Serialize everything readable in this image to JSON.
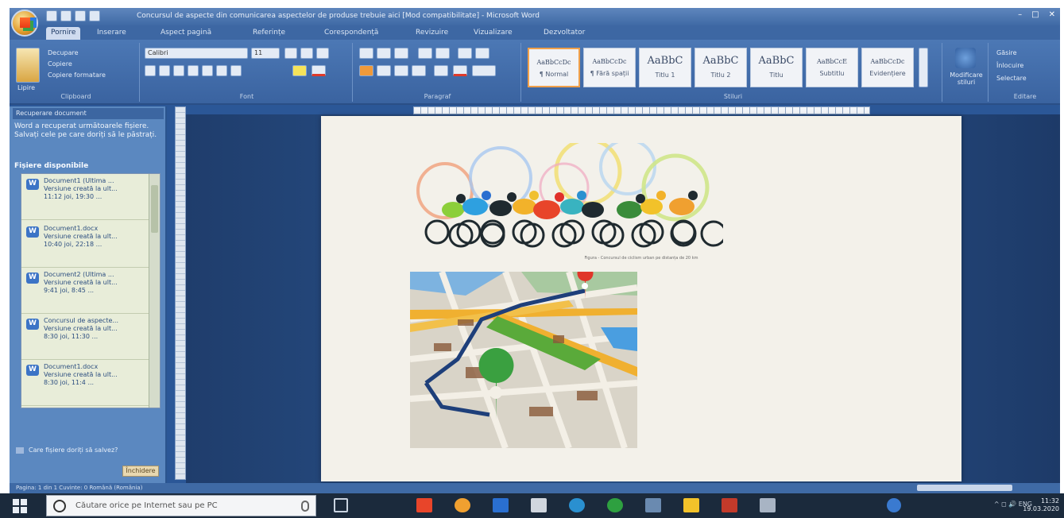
{
  "window": {
    "title": "Concursul de aspecte din comunicarea aspectelor de produse trebuie aici [Mod compatibilitate] - Microsoft Word",
    "controls": [
      "–",
      "□",
      "✕"
    ]
  },
  "tabs": [
    "Pornire",
    "Inserare",
    "Aspect pagină",
    "Referințe",
    "Corespondență",
    "Revizuire",
    "Vizualizare",
    "Dezvoltator"
  ],
  "ribbon": {
    "clipboard": {
      "paste": "Lipire",
      "cut": "Decupare",
      "copy": "Copiere",
      "format_painter": "Copiere formatare",
      "label": "Clipboard"
    },
    "font": {
      "name": "Calibri",
      "size": "11",
      "label": "Font"
    },
    "paragraph": {
      "label": "Paragraf"
    },
    "styles": {
      "label": "Stiluri",
      "items": [
        {
          "sample": "AaBbCcDc",
          "name": "¶ Normal"
        },
        {
          "sample": "AaBbCcDc",
          "name": "¶ Fără spații"
        },
        {
          "sample": "AaBbC",
          "name": "Titlu 1"
        },
        {
          "sample": "AaBbC",
          "name": "Titlu 2"
        },
        {
          "sample": "AaBbC",
          "name": "Titlu"
        },
        {
          "sample": "AaBbCcE",
          "name": "Subtitlu"
        },
        {
          "sample": "AaBbCcDc",
          "name": "Evidențiere"
        }
      ],
      "change_styles": "Modificare stiluri"
    },
    "editing": {
      "find": "Găsire",
      "replace": "Înlocuire",
      "select": "Selectare",
      "label": "Editare"
    }
  },
  "pane": {
    "header": "Recuperare document",
    "description": "Word a recuperat următoarele fișiere. Salvați cele pe care doriți să le păstrați.",
    "subheading": "Fișiere disponibile",
    "versions": [
      {
        "name": "Document1 (Ultima ...",
        "line2": "Versiune creată la ult...",
        "line3": "11:12 joi, 19:30 ..."
      },
      {
        "name": "Document1.docx",
        "line2": "Versiune creată la ult...",
        "line3": "10:40 joi, 22:18 ..."
      },
      {
        "name": "Document2 (Ultima ...",
        "line2": "Versiune creată la ult...",
        "line3": "9:41 joi, 8:45 ..."
      },
      {
        "name": "Concursul de aspecte...",
        "line2": "Versiune creată la ult...",
        "line3": "8:30 joi, 11:30 ..."
      },
      {
        "name": "Document1.docx",
        "line2": "Versiune creată la ult...",
        "line3": "8:30 joi, 11:4 ..."
      }
    ],
    "link": "Care fișiere doriți să salvez?",
    "close": "Închidere"
  },
  "document": {
    "caption": "Figura - Concursul de ciclism urban pe distanța de 20 km"
  },
  "status": {
    "text": "Pagina: 1 din 1   Cuvinte: 0   Română (România)"
  },
  "taskbar": {
    "search_placeholder": "Căutare orice pe Internet sau pe PC",
    "tray_text": "^  ◻  🔊  ENG",
    "time": "11:32",
    "date": "19.03.2020"
  },
  "colors": {
    "ribbon": "#3a63a0",
    "pane": "#5b88c0",
    "page": "#f3f1ea",
    "taskbar": "#1b2a3c"
  }
}
